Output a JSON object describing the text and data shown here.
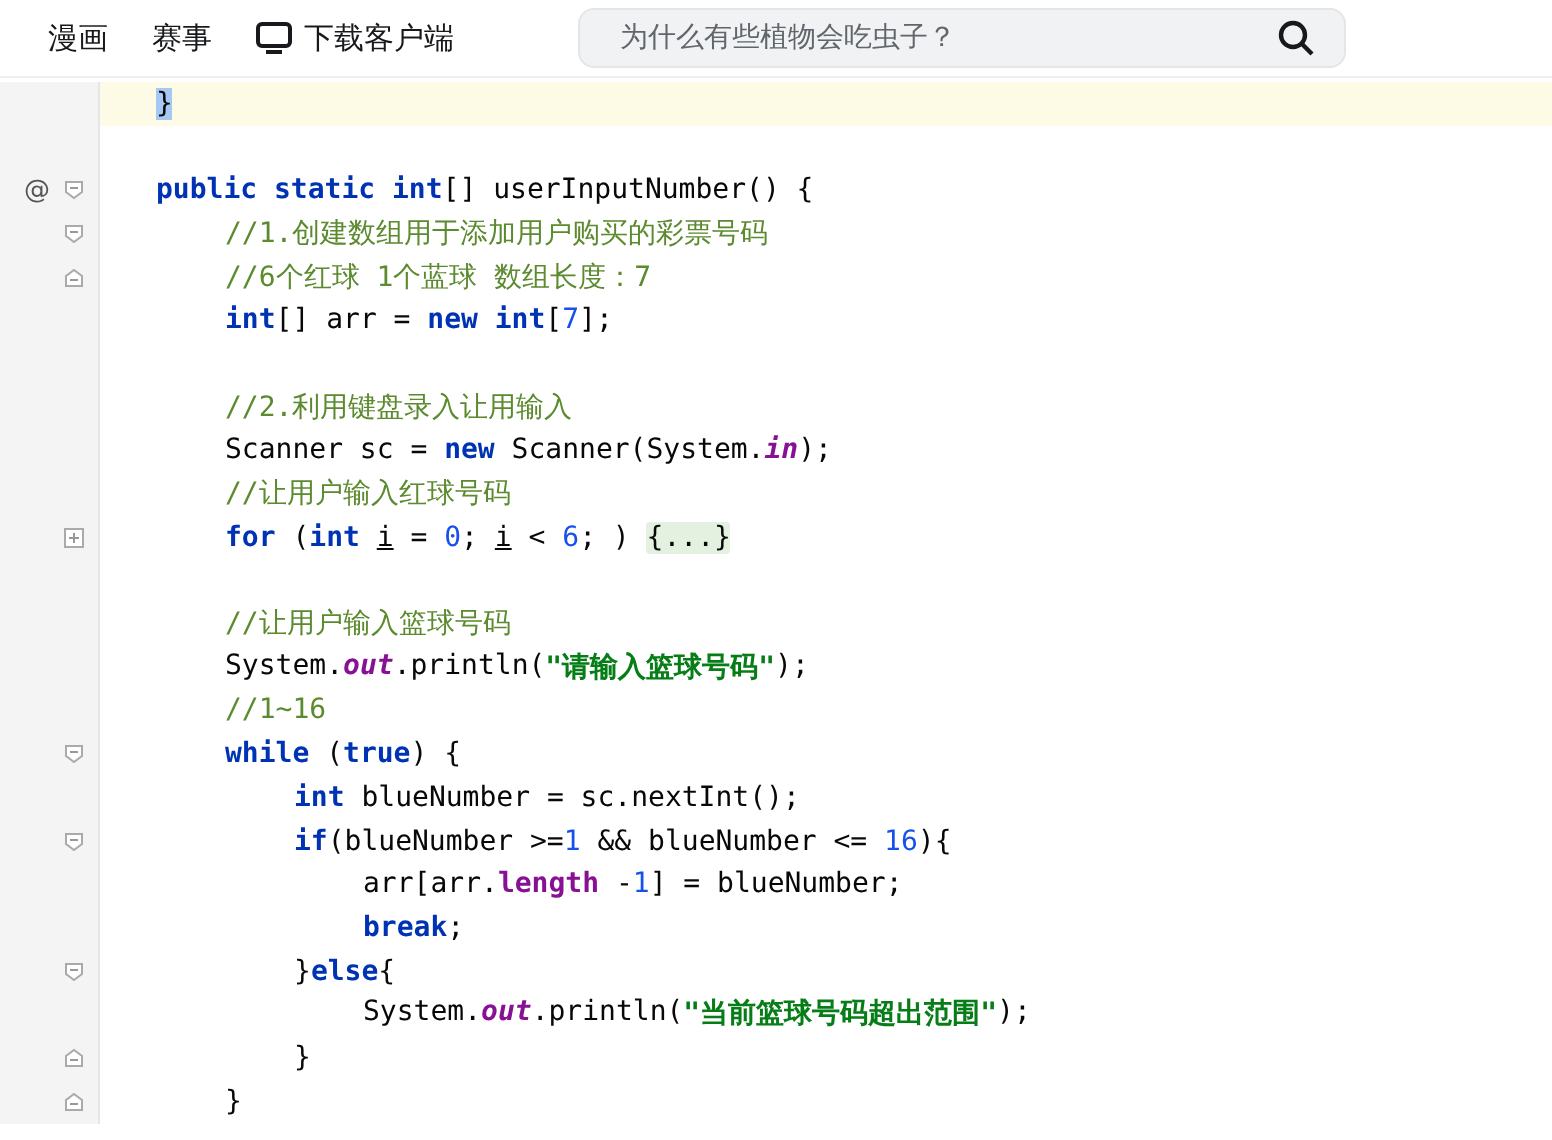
{
  "top_bar": {
    "links": [
      {
        "label": "漫画",
        "icon": false
      },
      {
        "label": "赛事",
        "icon": false
      },
      {
        "label": "下载客户端",
        "icon": true
      }
    ],
    "search": {
      "placeholder": "为什么有些植物会吃虫子？"
    }
  },
  "editor": {
    "lines": [
      {
        "kind": "code",
        "current": true,
        "tokens": [
          {
            "kind": "selected",
            "text": "}"
          }
        ]
      },
      {
        "kind": "blank",
        "current": false
      },
      {
        "kind": "fold-start",
        "current": false,
        "annotation": "@",
        "tokens": [
          {
            "kind": "keyword",
            "text": "public static int"
          },
          {
            "kind": "plain",
            "text": "[] userInputNumber() {"
          }
        ],
        "children": [
          {
            "kind": "fold-start",
            "current": false,
            "tokens": [
              {
                "kind": "comment",
                "text": "//1.创建数组用于添加用户购买的彩票号码"
              }
            ]
          },
          {
            "kind": "fold-end",
            "current": false,
            "tokens": [
              {
                "kind": "comment",
                "text": "//6个红球 1个蓝球 数组长度：7"
              }
            ]
          },
          {
            "kind": "code",
            "current": false,
            "tokens": [
              {
                "kind": "keyword",
                "text": "int"
              },
              {
                "kind": "plain",
                "text": "[] arr = "
              },
              {
                "kind": "keyword",
                "text": "new int"
              },
              {
                "kind": "plain",
                "text": "["
              },
              {
                "kind": "number",
                "text": "7"
              },
              {
                "kind": "plain",
                "text": "];"
              }
            ]
          },
          {
            "kind": "blank",
            "current": false
          },
          {
            "kind": "code",
            "current": false,
            "tokens": [
              {
                "kind": "comment",
                "text": "//2.利用键盘录入让用输入"
              }
            ]
          },
          {
            "kind": "code",
            "current": false,
            "tokens": [
              {
                "kind": "plain",
                "text": "Scanner sc = "
              },
              {
                "kind": "keyword",
                "text": "new"
              },
              {
                "kind": "plain",
                "text": " Scanner(System."
              },
              {
                "kind": "static",
                "text": "in"
              },
              {
                "kind": "plain",
                "text": ");"
              }
            ]
          },
          {
            "kind": "code",
            "current": false,
            "tokens": [
              {
                "kind": "comment",
                "text": "//让用户输入红球号码"
              }
            ]
          },
          {
            "kind": "folded",
            "current": false,
            "tokens": [
              {
                "kind": "keyword",
                "text": "for"
              },
              {
                "kind": "plain",
                "text": " ("
              },
              {
                "kind": "keyword",
                "text": "int "
              },
              {
                "kind": "variable",
                "text": "i"
              },
              {
                "kind": "plain",
                "text": " = "
              },
              {
                "kind": "number",
                "text": "0"
              },
              {
                "kind": "plain",
                "text": "; "
              },
              {
                "kind": "variable",
                "text": "i"
              },
              {
                "kind": "plain",
                "text": " < "
              },
              {
                "kind": "number",
                "text": "6"
              },
              {
                "kind": "plain",
                "text": "; ) "
              },
              {
                "kind": "folded",
                "text": "{...}"
              }
            ]
          },
          {
            "kind": "blank",
            "current": false
          },
          {
            "kind": "code",
            "current": false,
            "tokens": [
              {
                "kind": "comment",
                "text": "//让用户输入篮球号码"
              }
            ]
          },
          {
            "kind": "code",
            "current": false,
            "tokens": [
              {
                "kind": "plain",
                "text": "System."
              },
              {
                "kind": "static",
                "text": "out"
              },
              {
                "kind": "plain",
                "text": ".println("
              },
              {
                "kind": "string",
                "text": "\"请输入篮球号码\""
              },
              {
                "kind": "plain",
                "text": ");"
              }
            ]
          },
          {
            "kind": "code",
            "current": false,
            "tokens": [
              {
                "kind": "comment",
                "text": "//1~16"
              }
            ]
          },
          {
            "kind": "fold-start",
            "current": false,
            "tokens": [
              {
                "kind": "keyword",
                "text": "while"
              },
              {
                "kind": "plain",
                "text": " ("
              },
              {
                "kind": "keyword",
                "text": "true"
              },
              {
                "kind": "plain",
                "text": ") {"
              }
            ],
            "children": [
              {
                "kind": "code",
                "current": false,
                "tokens": [
                  {
                    "kind": "keyword",
                    "text": "int"
                  },
                  {
                    "kind": "plain",
                    "text": " blueNumber = sc.nextInt();"
                  }
                ]
              },
              {
                "kind": "fold-start",
                "current": false,
                "tokens": [
                  {
                    "kind": "keyword",
                    "text": "if"
                  },
                  {
                    "kind": "plain",
                    "text": "(blueNumber >="
                  },
                  {
                    "kind": "number",
                    "text": "1"
                  },
                  {
                    "kind": "plain",
                    "text": " && blueNumber <= "
                  },
                  {
                    "kind": "number",
                    "text": "16"
                  },
                  {
                    "kind": "plain",
                    "text": "){"
                  }
                ],
                "children": [
                  {
                    "kind": "code",
                    "current": false,
                    "tokens": [
                      {
                        "kind": "plain",
                        "text": "arr[arr."
                      },
                      {
                        "kind": "field",
                        "text": "length"
                      },
                      {
                        "kind": "plain",
                        "text": " -"
                      },
                      {
                        "kind": "number",
                        "text": "1"
                      },
                      {
                        "kind": "plain",
                        "text": "] = blueNumber;"
                      }
                    ]
                  },
                  {
                    "kind": "code",
                    "current": false,
                    "tokens": [
                      {
                        "kind": "keyword",
                        "text": "break"
                      },
                      {
                        "kind": "plain",
                        "text": ";"
                      }
                    ]
                  }
                ]
              },
              {
                "kind": "fold-start",
                "current": false,
                "tokens": [
                  {
                    "kind": "plain",
                    "text": "}"
                  },
                  {
                    "kind": "keyword",
                    "text": "else"
                  },
                  {
                    "kind": "plain",
                    "text": "{"
                  }
                ],
                "children": [
                  {
                    "kind": "code",
                    "current": false,
                    "tokens": [
                      {
                        "kind": "plain",
                        "text": "System."
                      },
                      {
                        "kind": "static",
                        "text": "out"
                      },
                      {
                        "kind": "plain",
                        "text": ".println("
                      },
                      {
                        "kind": "string",
                        "text": "\"当前篮球号码超出范围\""
                      },
                      {
                        "kind": "plain",
                        "text": ");"
                      }
                    ]
                  }
                ]
              },
              {
                "kind": "fold-end",
                "current": false,
                "tokens": [
                  {
                    "kind": "plain",
                    "text": "}"
                  }
                ]
              }
            ]
          },
          {
            "kind": "fold-end",
            "current": false,
            "tokens": [
              {
                "kind": "plain",
                "text": "}"
              }
            ]
          }
        ]
      }
    ]
  }
}
